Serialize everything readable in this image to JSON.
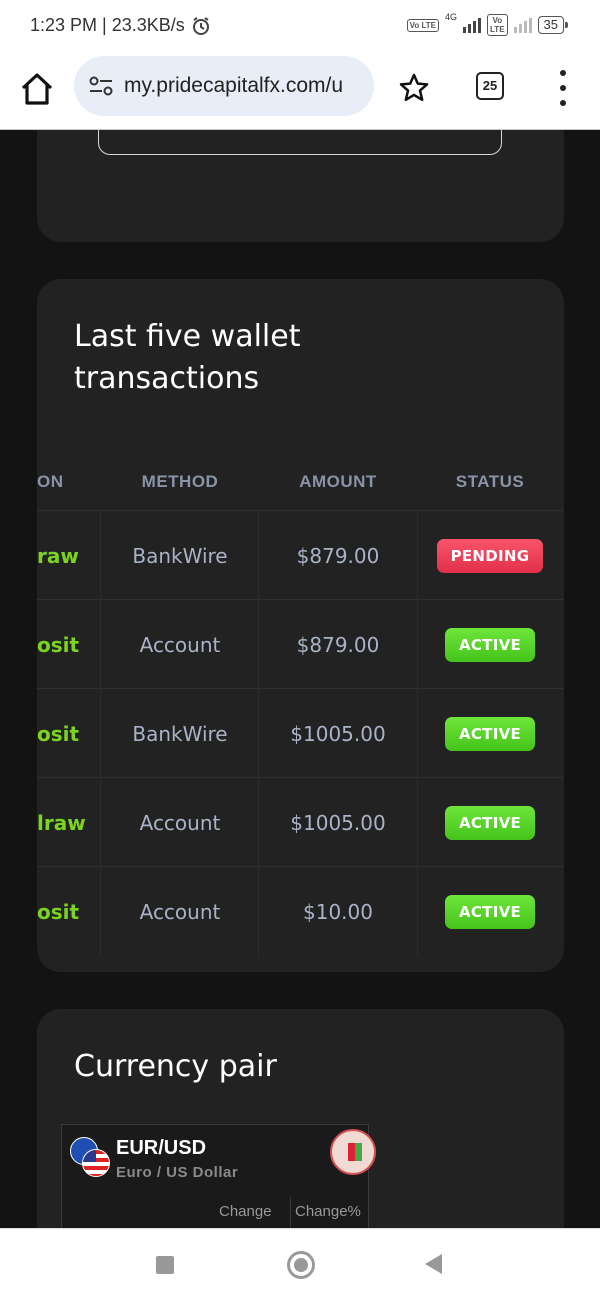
{
  "status_bar": {
    "time_speed": "1:23 PM | 23.3KB/s",
    "network": "4G",
    "volte": "Vo LTE",
    "battery": "35"
  },
  "browser": {
    "url": "my.pridecapitalfx.com/u",
    "tab_count": "25"
  },
  "transactions": {
    "title": "Last five wallet transactions",
    "headers": [
      "ON",
      "METHOD",
      "AMOUNT",
      "STATUS"
    ],
    "rows": [
      {
        "type": "raw",
        "method": "BankWire",
        "amount": "$879.00",
        "status": "PENDING"
      },
      {
        "type": "osit",
        "method": "Account",
        "amount": "$879.00",
        "status": "ACTIVE"
      },
      {
        "type": "osit",
        "method": "BankWire",
        "amount": "$1005.00",
        "status": "ACTIVE"
      },
      {
        "type": "lraw",
        "method": "Account",
        "amount": "$1005.00",
        "status": "ACTIVE"
      },
      {
        "type": "osit",
        "method": "Account",
        "amount": "$10.00",
        "status": "ACTIVE"
      }
    ]
  },
  "currency": {
    "title": "Currency pair",
    "pair": "EUR/USD",
    "pair_name": "Euro / US Dollar",
    "col_change": "Change",
    "col_change_pct": "Change%"
  },
  "colors": {
    "pending": "#e2304a",
    "active": "#45c41b",
    "type_text": "#7cd41f"
  }
}
